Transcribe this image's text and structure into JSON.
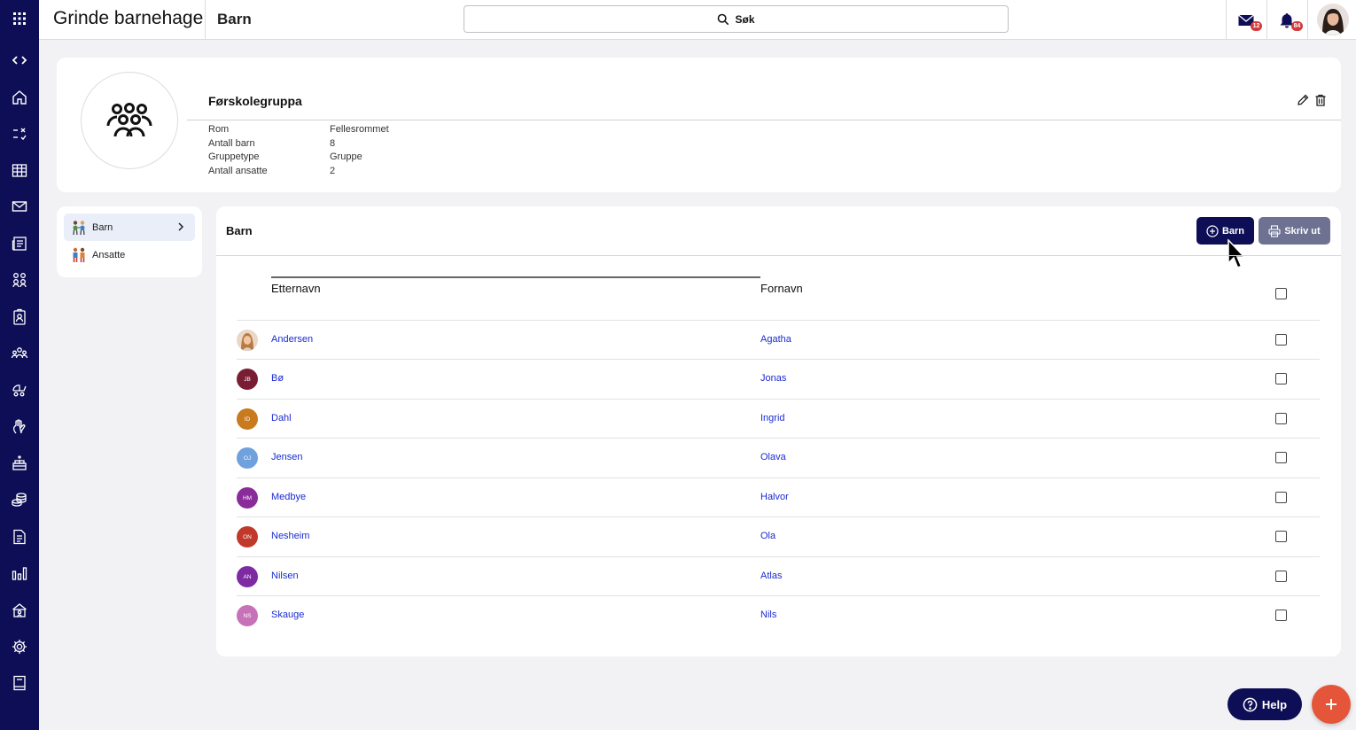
{
  "app": {
    "title": "Grinde barnehage",
    "page_title": "Barn"
  },
  "search": {
    "label": "Søk"
  },
  "notifications": {
    "messages_count": "12",
    "alerts_count": "84"
  },
  "group": {
    "name": "Førskolegruppa",
    "fields": [
      {
        "label": "Rom",
        "value": "Fellesrommet"
      },
      {
        "label": "Antall barn",
        "value": "8"
      },
      {
        "label": "Gruppetype",
        "value": "Gruppe"
      },
      {
        "label": "Antall ansatte",
        "value": "2"
      }
    ]
  },
  "sidenav": {
    "items": [
      {
        "label": "Barn"
      },
      {
        "label": "Ansatte"
      }
    ]
  },
  "list": {
    "title": "Barn",
    "add_button": "Barn",
    "print_button": "Skriv ut",
    "columns": {
      "last_name": "Etternavn",
      "first_name": "Fornavn"
    },
    "rows": [
      {
        "initials": "",
        "last_name": "Andersen",
        "first_name": "Agatha",
        "color": "#d9a77f"
      },
      {
        "initials": "JB",
        "last_name": "Bø",
        "first_name": "Jonas",
        "color": "#7a1d33"
      },
      {
        "initials": "ID",
        "last_name": "Dahl",
        "first_name": "Ingrid",
        "color": "#c87a1d"
      },
      {
        "initials": "OJ",
        "last_name": "Jensen",
        "first_name": "Olava",
        "color": "#6fa1dd"
      },
      {
        "initials": "HM",
        "last_name": "Medbye",
        "first_name": "Halvor",
        "color": "#8a2b9a"
      },
      {
        "initials": "ON",
        "last_name": "Nesheim",
        "first_name": "Ola",
        "color": "#c0392b"
      },
      {
        "initials": "AN",
        "last_name": "Nilsen",
        "first_name": "Atlas",
        "color": "#7d2aa3"
      },
      {
        "initials": "NS",
        "last_name": "Skauge",
        "first_name": "Nils",
        "color": "#c772b8"
      }
    ]
  },
  "help_button": "Help",
  "colors": {
    "rail": "#0e0e56",
    "primary": "#0e0e56",
    "secondary_button": "#6e7192",
    "fab": "#e5553a",
    "link": "#1a2bd1"
  }
}
